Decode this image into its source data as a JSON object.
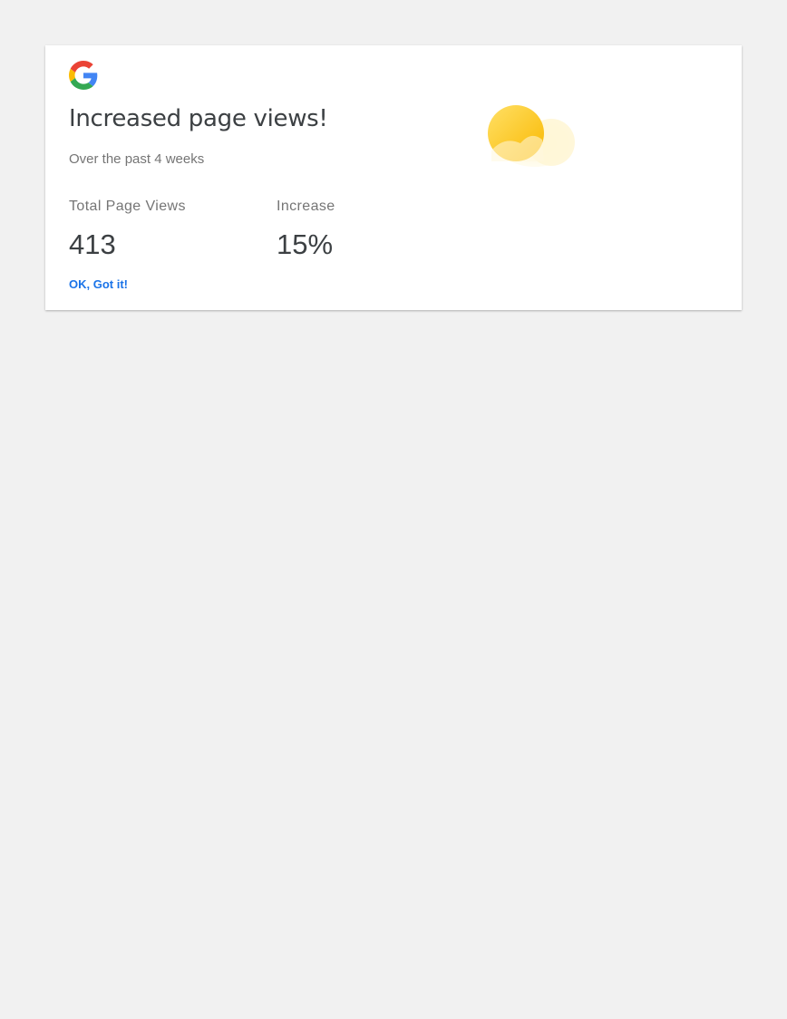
{
  "card": {
    "logo_icon": "google-g-icon",
    "title": "Increased page views!",
    "subtitle": "Over the past 4 weeks",
    "illustration_icon": "sun-cloud-icon",
    "stats": [
      {
        "label": "Total Page Views",
        "value": "413"
      },
      {
        "label": "Increase",
        "value": "15%"
      }
    ],
    "ok_label": "OK, Got it!"
  },
  "colors": {
    "background": "#f1f1f1",
    "card": "#ffffff",
    "title_text": "#3c4043",
    "secondary_text": "#757575",
    "accent": "#1a73e8",
    "sun": "#fbc02d"
  }
}
